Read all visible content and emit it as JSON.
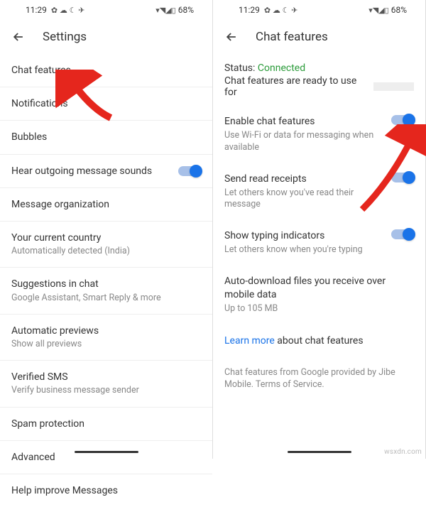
{
  "statusbar": {
    "time": "11:29",
    "battery": "68%"
  },
  "left": {
    "title": "Settings",
    "rows": [
      {
        "title": "Chat features",
        "sub": ""
      },
      {
        "title": "Notifications",
        "sub": ""
      },
      {
        "title": "Bubbles",
        "sub": ""
      },
      {
        "title": "Hear outgoing message sounds",
        "sub": "",
        "toggle": true
      },
      {
        "title": "Message organization",
        "sub": ""
      },
      {
        "title": "Your current country",
        "sub": "Automatically detected (India)"
      },
      {
        "title": "Suggestions in chat",
        "sub": "Google Assistant, Smart Reply & more"
      },
      {
        "title": "Automatic previews",
        "sub": "Show all previews"
      },
      {
        "title": "Verified SMS",
        "sub": "Verify business message sender"
      },
      {
        "title": "Spam protection",
        "sub": ""
      },
      {
        "title": "Advanced",
        "sub": ""
      },
      {
        "title": "Help improve Messages",
        "sub": ""
      }
    ]
  },
  "right": {
    "title": "Chat features",
    "status_label": "Status:",
    "status_value": "Connected",
    "status_ready": "Chat features are ready to use for",
    "rows": [
      {
        "title": "Enable chat features",
        "sub": "Use Wi-Fi or data for messaging when available",
        "toggle": true
      },
      {
        "title": "Send read receipts",
        "sub": "Let others know you've read their message",
        "toggle": true
      },
      {
        "title": "Show typing indicators",
        "sub": "Let others know when you're typing",
        "toggle": true
      },
      {
        "title": "Auto-download files you receive over mobile data",
        "sub": "Up to 105 MB"
      }
    ],
    "learn_link": "Learn more",
    "learn_rest": " about chat features",
    "footer": "Chat features from Google provided by Jibe Mobile. Terms of Service."
  },
  "watermark": "wsxdn.com"
}
